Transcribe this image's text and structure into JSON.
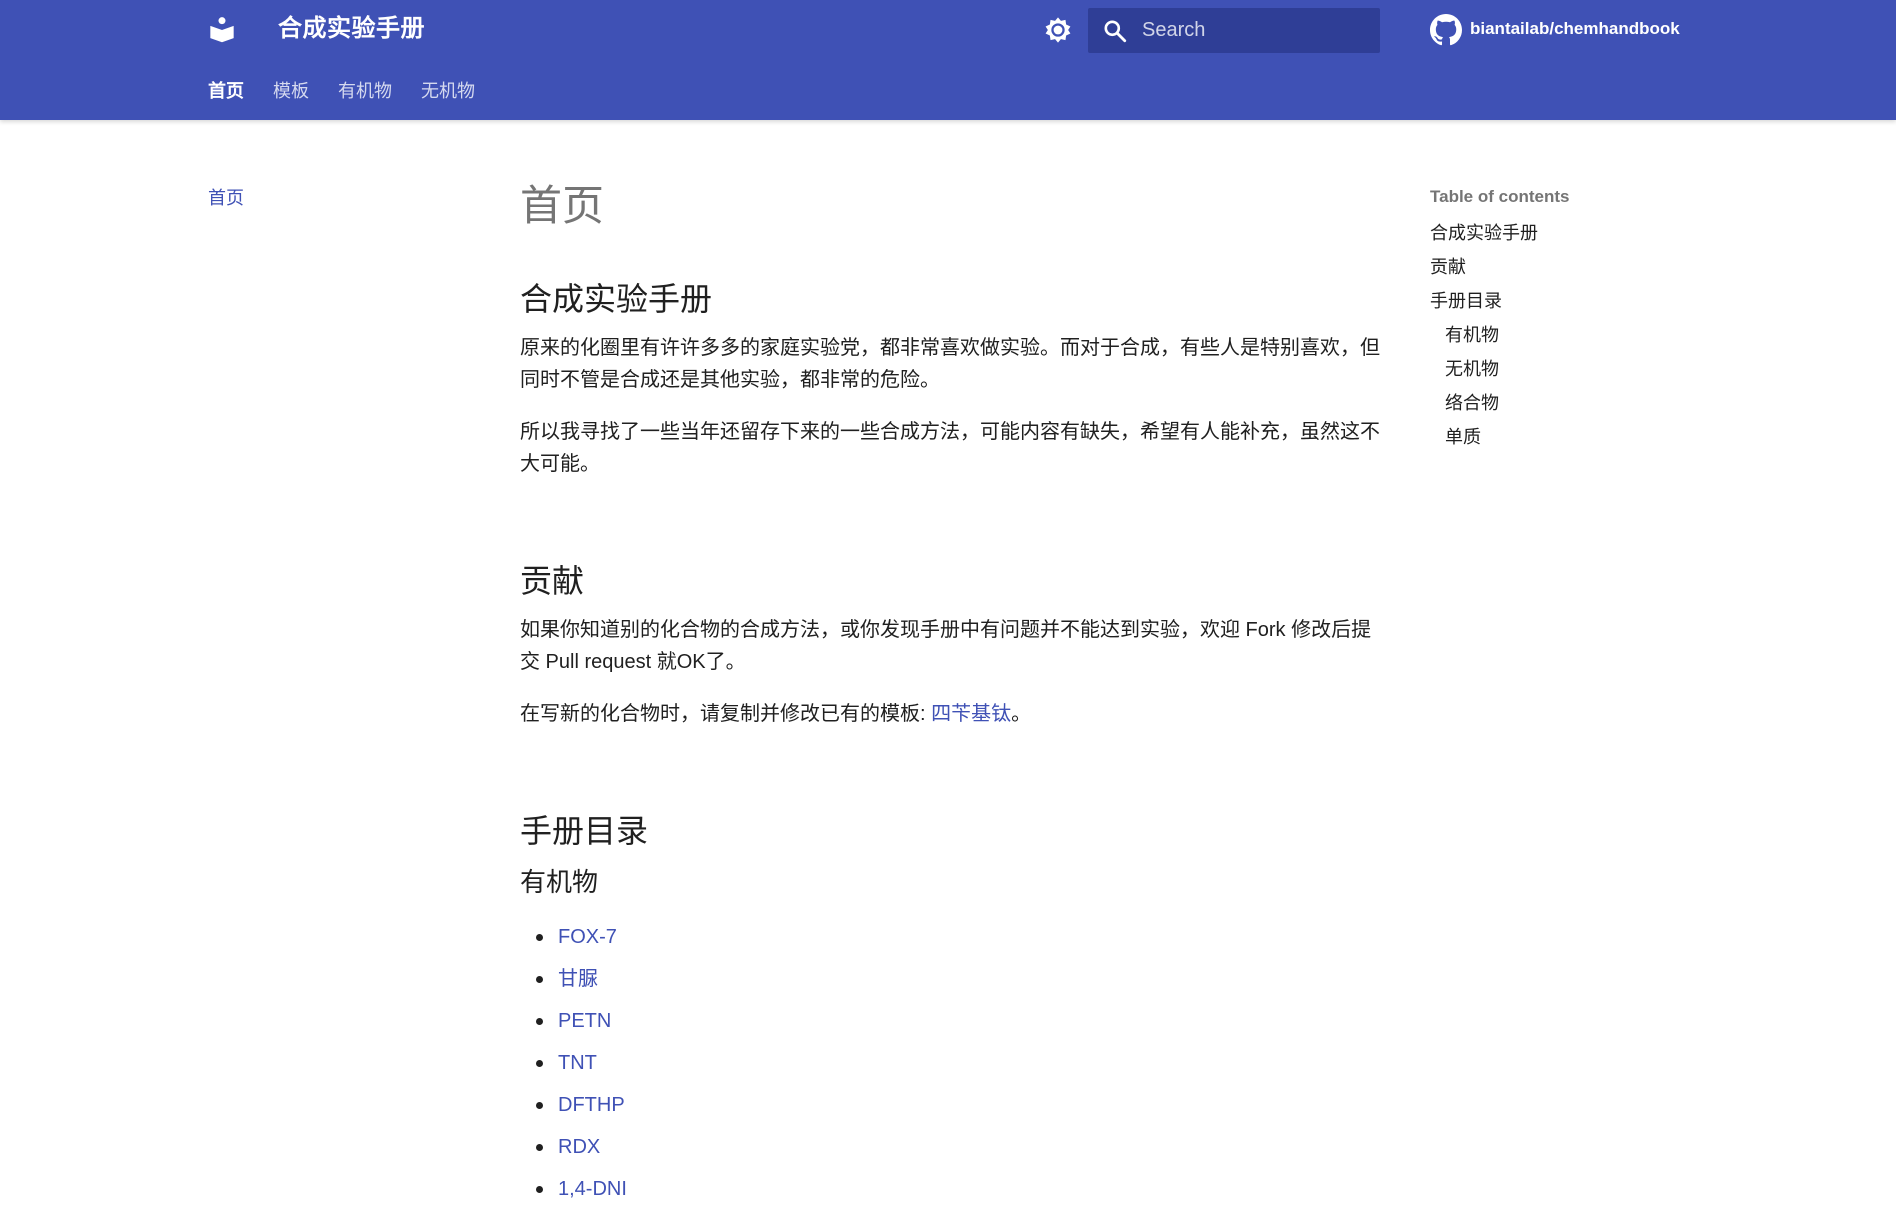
{
  "header": {
    "site_title": "合成实验手册",
    "search_placeholder": "Search",
    "repo_name": "biantailab/chemhandbook",
    "brand_color": "#3f51b5"
  },
  "tabs": [
    {
      "label": "首页",
      "active": true
    },
    {
      "label": "模板",
      "active": false
    },
    {
      "label": "有机物",
      "active": false
    },
    {
      "label": "无机物",
      "active": false
    }
  ],
  "left_nav": {
    "items": [
      {
        "label": "首页"
      }
    ]
  },
  "content": {
    "page_title": "首页",
    "sections": {
      "intro": {
        "heading": "合成实验手册",
        "p1": "原来的化圈里有许许多多的家庭实验党，都非常喜欢做实验。而对于合成，有些人是特别喜欢，但同时不管是合成还是其他实验，都非常的危险。",
        "p2": "所以我寻找了一些当年还留存下来的一些合成方法，可能内容有缺失，希望有人能补充，虽然这不大可能。"
      },
      "contribute": {
        "heading": "贡献",
        "p1": "如果你知道别的化合物的合成方法，或你发现手册中有问题并不能达到实验，欢迎 Fork 修改后提交 Pull request 就OK了。",
        "p2_prefix": "在写新的化合物时，请复制并修改已有的模板: ",
        "p2_link": "四苄基钛",
        "p2_suffix": "。"
      },
      "catalog": {
        "heading": "手册目录",
        "organic_heading": "有机物",
        "organic_items": [
          "FOX-7",
          "甘脲",
          "PETN",
          "TNT",
          "DFTHP",
          "RDX",
          "1,4-DNI"
        ]
      }
    }
  },
  "toc": {
    "title": "Table of contents",
    "items": [
      {
        "label": "合成实验手册",
        "level": 1
      },
      {
        "label": "贡献",
        "level": 1
      },
      {
        "label": "手册目录",
        "level": 1
      },
      {
        "label": "有机物",
        "level": 2
      },
      {
        "label": "无机物",
        "level": 2
      },
      {
        "label": "络合物",
        "level": 2
      },
      {
        "label": "单质",
        "level": 2
      }
    ]
  },
  "icons": {
    "logo": "book-reader-icon",
    "theme": "brightness-icon",
    "search": "search-icon",
    "repo": "github-icon"
  }
}
